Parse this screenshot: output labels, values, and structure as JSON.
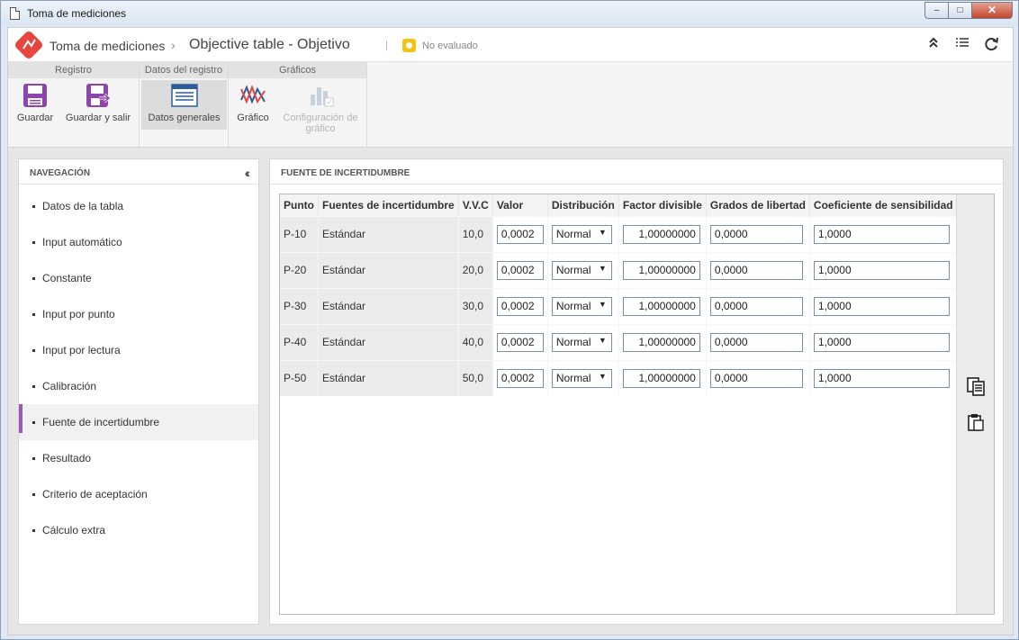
{
  "window": {
    "title": "Toma de mediciones",
    "min_label": "‒",
    "max_label": "□",
    "close_label": "✕"
  },
  "header": {
    "breadcrumb_root": "Toma de mediciones",
    "breadcrumb_sep": "›",
    "page_title": "Objective table - Objetivo",
    "separator": "|",
    "status": "No evaluado",
    "status_color": "#f1c40f",
    "icons": [
      "collapse-up-icon",
      "list-icon",
      "refresh-icon"
    ]
  },
  "ribbon": {
    "groups": [
      {
        "title": "Registro",
        "buttons": [
          {
            "label": "Guardar",
            "icon": "save-icon"
          },
          {
            "label": "Guardar y salir",
            "icon": "save-exit-icon"
          }
        ]
      },
      {
        "title": "Datos del registro",
        "buttons": [
          {
            "label": "Datos generales",
            "icon": "form-icon",
            "active": true
          }
        ]
      },
      {
        "title": "Gráficos",
        "buttons": [
          {
            "label": "Gráfico",
            "icon": "chart-icon"
          },
          {
            "label": "Configuración de gráfico",
            "icon": "chart-config-icon",
            "disabled": true
          }
        ]
      }
    ]
  },
  "navigation": {
    "title": "NAVEGACIÓN",
    "items": [
      "Datos de la tabla",
      "Input automático",
      "Constante",
      "Input por punto",
      "Input por lectura",
      "Calibración",
      "Fuente de incertidumbre",
      "Resultado",
      "Criterio de aceptación",
      "Cálculo extra"
    ],
    "active_index": 6,
    "accent_color": "#9b59b6"
  },
  "main": {
    "title": "FUENTE DE INCERTIDUMBRE",
    "columns": [
      "Punto",
      "Fuentes de incertidumbre",
      "V.V.C",
      "Valor",
      "Distribución",
      "Factor divisible",
      "Grados de libertad",
      "Coeficiente de sensibilidad"
    ],
    "rows": [
      {
        "punto": "P-10",
        "fuente": "Estándar",
        "vvc": "10,0",
        "valor": "0,0002",
        "distribucion": "Normal",
        "factor": "1,00000000",
        "grados": "0,0000",
        "coeficiente": "1,0000"
      },
      {
        "punto": "P-20",
        "fuente": "Estándar",
        "vvc": "20,0",
        "valor": "0,0002",
        "distribucion": "Normal",
        "factor": "1,00000000",
        "grados": "0,0000",
        "coeficiente": "1,0000"
      },
      {
        "punto": "P-30",
        "fuente": "Estándar",
        "vvc": "30,0",
        "valor": "0,0002",
        "distribucion": "Normal",
        "factor": "1,00000000",
        "grados": "0,0000",
        "coeficiente": "1,0000"
      },
      {
        "punto": "P-40",
        "fuente": "Estándar",
        "vvc": "40,0",
        "valor": "0,0002",
        "distribucion": "Normal",
        "factor": "1,00000000",
        "grados": "0,0000",
        "coeficiente": "1,0000"
      },
      {
        "punto": "P-50",
        "fuente": "Estándar",
        "vvc": "50,0",
        "valor": "0,0002",
        "distribucion": "Normal",
        "factor": "1,00000000",
        "grados": "0,0000",
        "coeficiente": "1,0000"
      }
    ],
    "side_tools": [
      "copy-icon",
      "paste-icon"
    ]
  }
}
